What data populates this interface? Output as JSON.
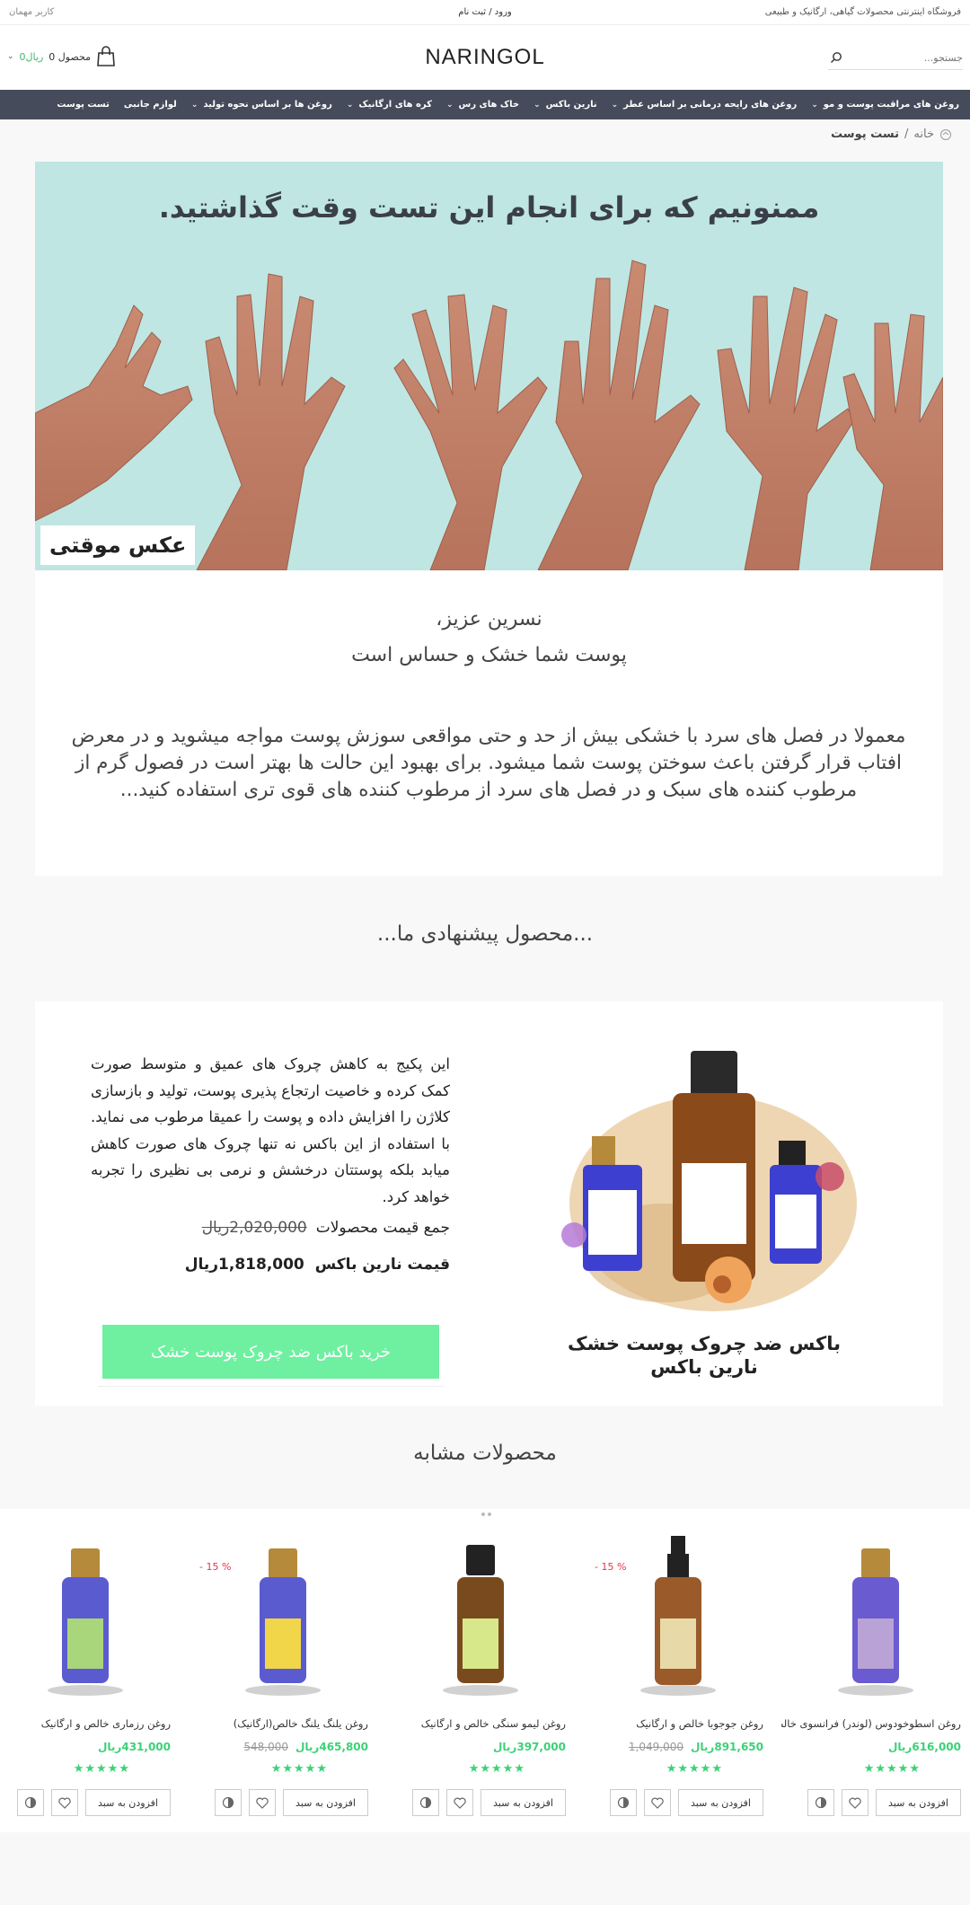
{
  "topbar": {
    "tagline": "فروشگاه اینترنتی محصولات گیاهی، ارگانیک و طبیعی",
    "login": "ورود / ثبت نام",
    "guest": "کاربر مهمان"
  },
  "header": {
    "search_placeholder": "جستجو...",
    "logo": "NARINGOL",
    "cart_count": "0 محصول",
    "cart_total": "0ریال"
  },
  "nav": {
    "items": [
      {
        "label": "روغن های مراقبت پوست و مو",
        "has_dropdown": true
      },
      {
        "label": "روغن های رایحه درمانی بر اساس عطر",
        "has_dropdown": true
      },
      {
        "label": "نارین باکس",
        "has_dropdown": true
      },
      {
        "label": "خاک های رس",
        "has_dropdown": true
      },
      {
        "label": "کره های ارگانیک",
        "has_dropdown": true
      },
      {
        "label": "روغن ها بر اساس نحوه تولید",
        "has_dropdown": true
      },
      {
        "label": "لوازم جانبی",
        "has_dropdown": false
      },
      {
        "label": "تست پوست",
        "has_dropdown": false
      }
    ]
  },
  "breadcrumb": {
    "home": "خانه",
    "sep": "/",
    "current": "تست پوست"
  },
  "hero": {
    "title": "ممنونیم که برای انجام این تست وقت گذاشتید.",
    "temp_label": "عکس موقتی"
  },
  "result": {
    "greeting": "نسرین عزیز،",
    "skin_type": "پوست شما خشک  و حساس است",
    "description": "معمولا در فصل های سرد با خشکی بیش از حد و حتی مواقعی سوزش پوست مواجه میشوید و در معرض افتاب قرار گرفتن باعث سوختن پوست شما میشود. برای بهبود این حالت ها بهتر است در فصول گرم از مرطوب کننده های سبک و در فصل های سرد از مرطوب کننده های قوی تری استفاده کنید..."
  },
  "suggest_title": "...محصول پیشنهادی ما...",
  "box": {
    "description": "این پکیج به کاهش چروک های عمیق و متوسط صورت کمک کرده و خاصیت ارتجاع پذیری پوست، تولید و بازسازی کلاژن را افزایش داده و پوست را عمیقا مرطوب می نماید. با استفاده از این باکس نه تنها چروک های صورت کاهش میابد بلکه پوستتان درخشش و نرمی بی نظیری را تجربه خواهد کرد.",
    "total_label": "جمع قیمت محصولات",
    "total_value": "2,020,000ریال",
    "box_label": "قیمت نارین باکس",
    "box_value": "1,818,000ریال",
    "buy_label": "خرید باکس ضد چروک پوست خشک",
    "name": "باکس ضد چروک پوست خشک نارین باکس"
  },
  "similar_title": "محصولات مشابه",
  "products": [
    {
      "name": "روغن اسطوخودوس (لوندر) فرانسوی خالص",
      "price": "616,000ریال",
      "old_price": "",
      "badge": "",
      "label_color": "#b9a3d6",
      "glass": "#6a5bd0",
      "cap": "#b58a3a",
      "add": "افزودن به سبد",
      "stars": "★★★★★"
    },
    {
      "name": "روغن جوجوبا خالص و ارگانیک",
      "price": "891,650ریال",
      "old_price": "1,049,000",
      "badge": "- 15 %",
      "label_color": "#e8d9a8",
      "glass": "#9a5a2a",
      "cap": "#222",
      "add": "افزودن به سبد",
      "stars": "★★★★★"
    },
    {
      "name": "روغن لیمو سنگی خالص و ارگانیک",
      "price": "397,000ریال",
      "old_price": "",
      "badge": "",
      "label_color": "#d7e88a",
      "glass": "#7a4a1f",
      "cap": "#222",
      "add": "افزودن به سبد",
      "stars": "★★★★★"
    },
    {
      "name": "روغن یلنگ یلنگ خالص(ارگانیک)",
      "price": "465,800ریال",
      "old_price": "548,000",
      "badge": "- 15 %",
      "label_color": "#f2d64a",
      "glass": "#5b5bd0",
      "cap": "#b58a3a",
      "add": "افزودن به سبد",
      "stars": "★★★★★"
    },
    {
      "name": "روغن رزماری خالص و ارگانیک",
      "price": "431,000ریال",
      "old_price": "",
      "badge": "",
      "label_color": "#a9d67a",
      "glass": "#5b5bd0",
      "cap": "#b58a3a",
      "add": "افزودن به سبد",
      "stars": "★★★★★"
    }
  ],
  "colors": {
    "nav_bg": "#454b5a",
    "accent_green": "#3cd177",
    "buy_button": "#6ef0a0",
    "hero_bg": "#bfe6e3",
    "sale_badge": "#e8334a"
  }
}
